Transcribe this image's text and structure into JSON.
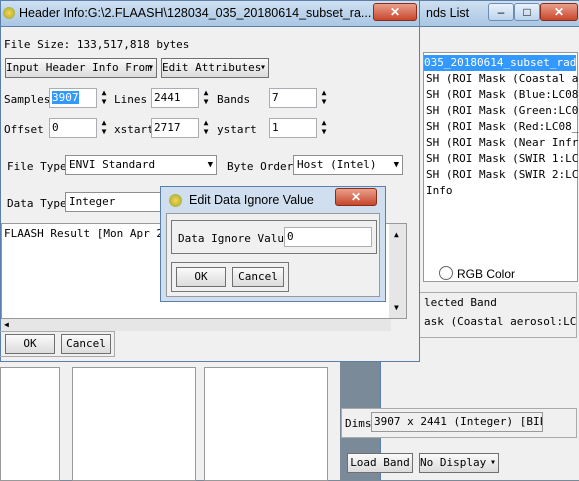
{
  "header_window": {
    "title": "Header Info:G:\\2.FLAASH\\128034_035_20180614_subset_ra...",
    "file_size_label": "File Size: 133,517,818 bytes",
    "input_header_button": "Input Header Info From",
    "edit_attributes_button": "Edit Attributes",
    "samples_label": "Samples",
    "samples_value": "3907",
    "lines_label": "Lines",
    "lines_value": "2441",
    "bands_label": "Bands",
    "bands_value": "7",
    "offset_label": "Offset",
    "offset_value": "0",
    "xstart_label": "xstart",
    "xstart_value": "2717",
    "ystart_label": "ystart",
    "ystart_value": "1",
    "file_type_label": "File Type",
    "file_type_value": "ENVI Standard",
    "byte_order_label": "Byte Order",
    "byte_order_value": "Host (Intel)",
    "data_type_label": "Data Type",
    "data_type_value": "Integer",
    "description_text": "FLAASH Result [Mon Apr 20",
    "ok_button": "OK",
    "cancel_button": "Cancel"
  },
  "bands_window": {
    "title_fragment": "nds List",
    "list_items": [
      "035_20180614_subset_rad",
      "SH (ROI Mask (Coastal a",
      "SH (ROI Mask (Blue:LC08",
      "SH (ROI Mask (Green:LC0",
      "SH (ROI Mask (Red:LC08_",
      "SH (ROI Mask (Near Infr",
      "SH (ROI Mask (SWIR 1:LC",
      "SH (ROI Mask (SWIR 2:LC",
      "Info"
    ],
    "rgb_color_label": "RGB Color",
    "selected_band_label": "lected Band",
    "selected_band_value": "ask (Coastal aerosol:LC",
    "dims_label": "Dims",
    "dims_value": "3907 x 2441 (Integer) [BIL]",
    "load_band_button": "Load Band",
    "no_display_button": "No Display"
  },
  "dialog": {
    "title": "Edit Data Ignore Value",
    "field_label": "Data Ignore Value",
    "field_value": "0",
    "ok_button": "OK",
    "cancel_button": "Cancel"
  },
  "titlebar_controls": {
    "minimize": "–",
    "maximize": "□",
    "close": "✕"
  }
}
